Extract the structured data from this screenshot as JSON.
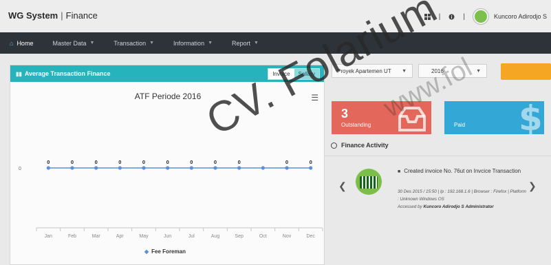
{
  "header": {
    "app_name": "WG System",
    "module": "Finance",
    "user_name": "Kuncoro Adirodjo S"
  },
  "nav": {
    "items": [
      {
        "label": "Home",
        "icon": "home-icon"
      },
      {
        "label": "Master Data",
        "icon": "caret-down-icon"
      },
      {
        "label": "Transaction",
        "icon": "caret-down-icon"
      },
      {
        "label": "Information",
        "icon": "caret-down-icon"
      },
      {
        "label": "Report",
        "icon": "caret-down-icon"
      }
    ]
  },
  "panel": {
    "title": "Average Transaction Finance",
    "toggle": [
      "Invoice",
      "Sallary"
    ],
    "accent": "#26b3bb"
  },
  "chart_data": {
    "type": "line",
    "title": "ATF Periode 2016",
    "categories": [
      "Jan",
      "Feb",
      "Mar",
      "Apr",
      "May",
      "Jun",
      "Jul",
      "Aug",
      "Sep",
      "Oct",
      "Nov",
      "Dec"
    ],
    "series": [
      {
        "name": "Fee Foreman",
        "values": [
          0,
          0,
          0,
          0,
          0,
          0,
          0,
          0,
          0,
          0,
          0,
          0
        ],
        "color": "#5b8fd6"
      }
    ],
    "data_labels": [
      "0",
      "0",
      "0",
      "0",
      "0",
      "0",
      "0",
      "0",
      "0",
      "",
      "0",
      "0"
    ],
    "y_ticks": [
      "0"
    ],
    "xlabel": "",
    "ylabel": "",
    "grid": false,
    "legend_position": "bottom"
  },
  "filters": {
    "project": "Proyek Apartemen UT",
    "year": "2016"
  },
  "cards": {
    "outstanding": {
      "count": "3",
      "label": "Outstanding",
      "color": "#e3675a"
    },
    "paid": {
      "count": "",
      "label": "Paid",
      "color": "#33a7d6"
    }
  },
  "activity": {
    "title": "Finance Activity",
    "message": "Created invoice No. 76ut on Invcice Transaction",
    "meta": "30 Des 2015 / 15:50 | Ip : 192.168.1.6 | Browser : Firefox | Platform : Unknown Windows OS",
    "accessed_prefix": "Accessed by",
    "accessed_by": "Kuncoro Adirodjo S",
    "role": "Administrator"
  },
  "watermark": {
    "main": "CV. Folarium",
    "sub": "www.fol"
  }
}
